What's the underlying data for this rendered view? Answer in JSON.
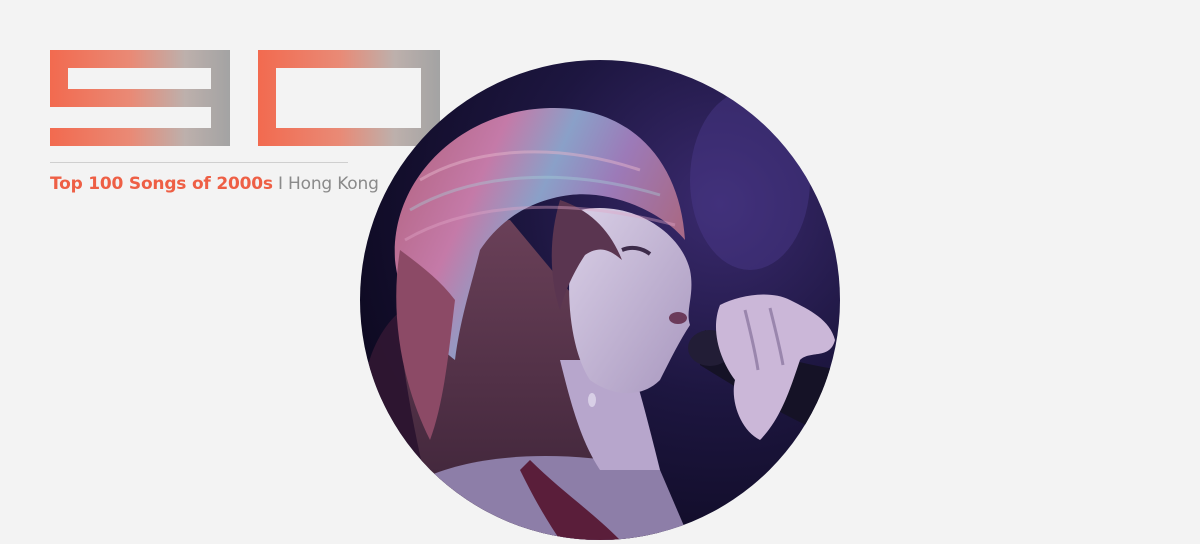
{
  "rank": {
    "number": "90",
    "gradient_start": "#f26a4f",
    "gradient_end": "#a3a3a3"
  },
  "subtitle": {
    "title": "Top 100 Songs of 2000s",
    "separator": "I",
    "region": "Hong Kong",
    "title_color": "#ee5f45",
    "region_color": "#8a8a8a"
  },
  "photo": {
    "subject": "singer-with-knit-hat-and-microphone"
  }
}
